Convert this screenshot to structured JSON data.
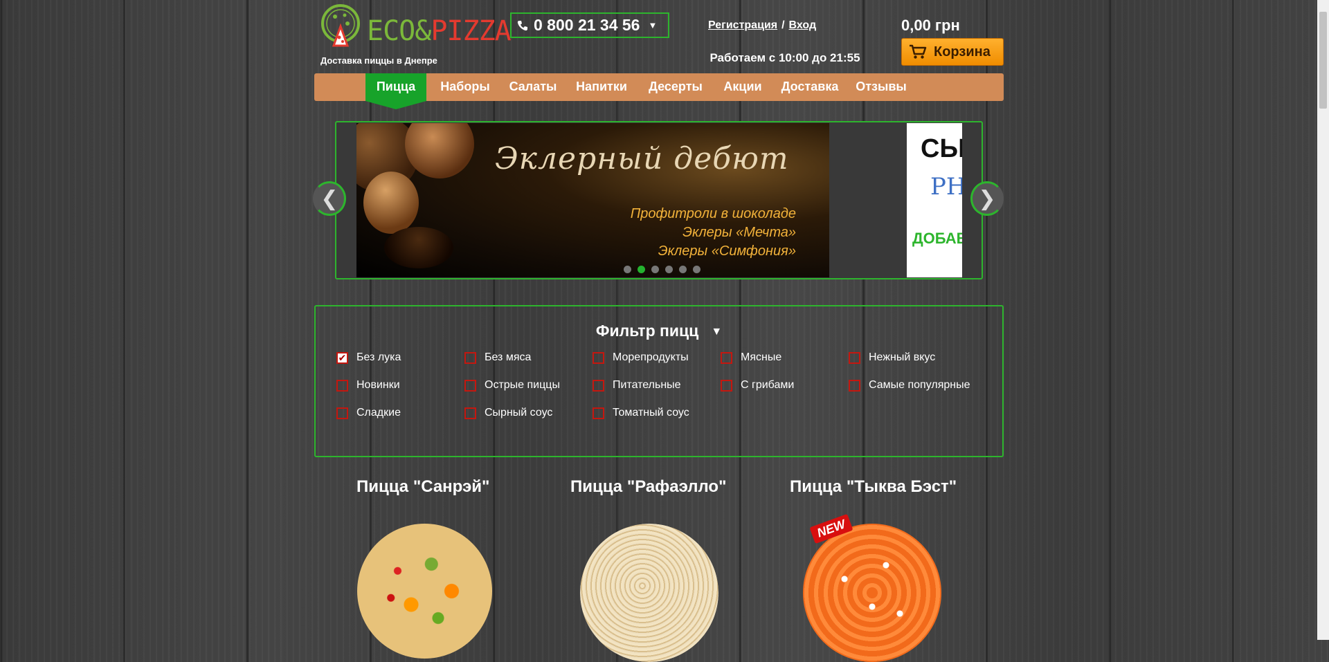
{
  "header": {
    "logo_eco": "ECO",
    "logo_amp": "&",
    "logo_pizza": "PIZZA",
    "tagline": "Доставка пиццы в Днепре",
    "phone": "0 800 21 34 56",
    "register": "Регистрация",
    "auth_sep": "/",
    "login": "Вход",
    "hours": "Работаем с 10:00 до 21:55",
    "cart_sum": "0,00 грн",
    "cart_label": "Корзина"
  },
  "nav": {
    "items": [
      "Пицца",
      "Наборы",
      "Салаты",
      "Напитки",
      "Десерты",
      "Акции",
      "Доставка",
      "Отзывы"
    ],
    "active": "Пицца"
  },
  "slider": {
    "slide1_title": "Эклерный дебют",
    "slide1_line1": "Профитроли в шоколаде",
    "slide1_line2": "Эклеры «Мечта»",
    "slide1_line3": "Эклеры «Симфония»",
    "slide2_t1": "СЫ",
    "slide2_t2": "PH",
    "slide2_t3": "ДОБАВ",
    "dot_count": 6,
    "active_dot": 2,
    "prev": "❮",
    "next": "❯"
  },
  "filter": {
    "title": "Фильтр пицц",
    "items": [
      {
        "label": "Без лука",
        "checked": true
      },
      {
        "label": "Без мяса",
        "checked": false
      },
      {
        "label": "Морепродукты",
        "checked": false
      },
      {
        "label": "Мясные",
        "checked": false
      },
      {
        "label": "Нежный вкус",
        "checked": false
      },
      {
        "label": "Новинки",
        "checked": false
      },
      {
        "label": "Острые пиццы",
        "checked": false
      },
      {
        "label": "Питательные",
        "checked": false
      },
      {
        "label": "С грибами",
        "checked": false
      },
      {
        "label": "Самые популярные",
        "checked": false
      },
      {
        "label": "Сладкие",
        "checked": false
      },
      {
        "label": "Сырный соус",
        "checked": false
      },
      {
        "label": "Томатный соус",
        "checked": false
      }
    ]
  },
  "products": [
    {
      "title": "Пицца \"Санрэй\""
    },
    {
      "title": "Пицца \"Рафаэлло\""
    },
    {
      "title": "Пицца \"Тыква Бэст\"",
      "badge": "NEW"
    }
  ],
  "colors": {
    "accent_green": "#2db52d",
    "nav_bg": "#d28b57",
    "nav_active": "#17a32a",
    "cart_orange": "#f5a000",
    "checkbox_red": "#c4170f"
  }
}
